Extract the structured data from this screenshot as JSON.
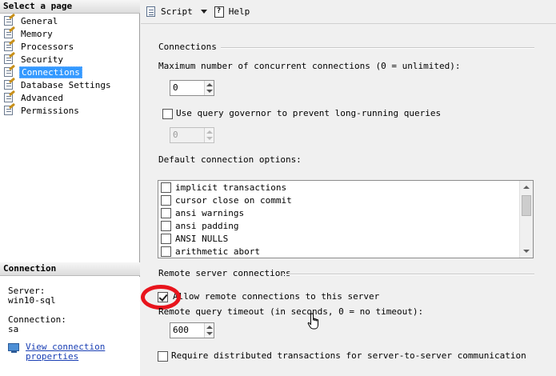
{
  "left_panel": {
    "select_page_header": "Select a page",
    "pages": [
      {
        "label": "General",
        "selected": false
      },
      {
        "label": "Memory",
        "selected": false
      },
      {
        "label": "Processors",
        "selected": false
      },
      {
        "label": "Security",
        "selected": false
      },
      {
        "label": "Connections",
        "selected": true
      },
      {
        "label": "Database Settings",
        "selected": false
      },
      {
        "label": "Advanced",
        "selected": false
      },
      {
        "label": "Permissions",
        "selected": false
      }
    ],
    "connection_header": "Connection",
    "server_label": "Server:",
    "server_value": "win10-sql",
    "connection_label": "Connection:",
    "connection_value": "sa",
    "view_link": "View connection properties"
  },
  "toolbar": {
    "script_label": "Script",
    "help_label": "Help"
  },
  "connections": {
    "section_title": "Connections",
    "max_label": "Maximum number of concurrent connections (0 = unlimited):",
    "max_value": "0",
    "governor_label": "Use query governor to prevent long-running queries",
    "governor_checked": false,
    "governor_value": "0",
    "default_options_label": "Default connection options:",
    "default_options": [
      {
        "label": "implicit transactions",
        "checked": false
      },
      {
        "label": "cursor close on commit",
        "checked": false
      },
      {
        "label": "ansi warnings",
        "checked": false
      },
      {
        "label": "ansi padding",
        "checked": false
      },
      {
        "label": "ANSI NULLS",
        "checked": false
      },
      {
        "label": "arithmetic abort",
        "checked": false
      }
    ]
  },
  "remote": {
    "section_title": "Remote server connections",
    "allow_label": "Allow remote connections to this server",
    "allow_checked": true,
    "timeout_label": "Remote query timeout (in seconds, 0 = no timeout):",
    "timeout_value": "600",
    "distributed_label": "Require distributed transactions for server-to-server communication",
    "distributed_checked": false
  },
  "colors": {
    "selection": "#3399ff",
    "highlight_ring": "#e8141c",
    "link": "#1a3fb4"
  }
}
